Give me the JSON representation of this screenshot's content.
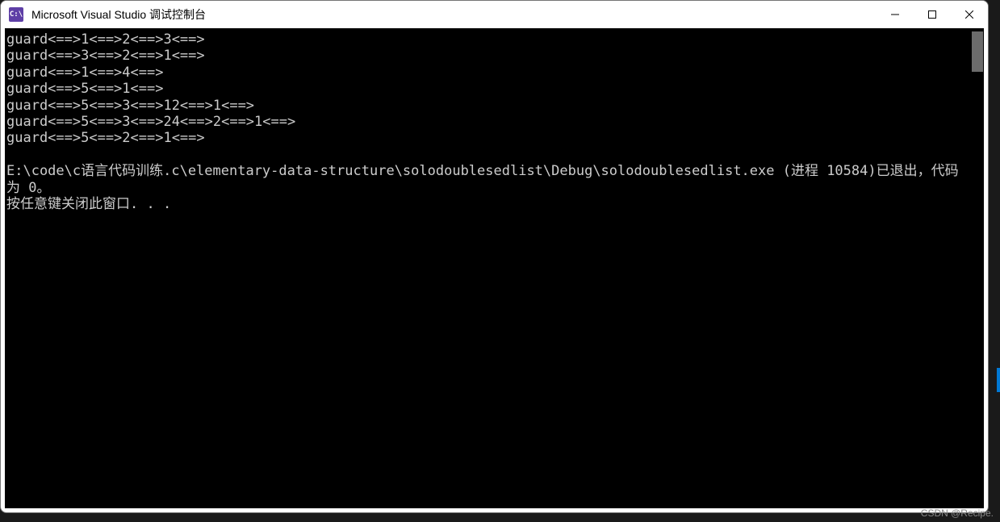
{
  "window": {
    "title": "Microsoft Visual Studio 调试控制台",
    "icon_text": "C:\\"
  },
  "console": {
    "lines": [
      "guard<==>1<==>2<==>3<==>",
      "guard<==>3<==>2<==>1<==>",
      "guard<==>1<==>4<==>",
      "guard<==>5<==>1<==>",
      "guard<==>5<==>3<==>12<==>1<==>",
      "guard<==>5<==>3<==>24<==>2<==>1<==>",
      "guard<==>5<==>2<==>1<==>",
      "",
      "E:\\code\\c语言代码训练.c\\elementary-data-structure\\solodoublesedlist\\Debug\\solodoublesedlist.exe (进程 10584)已退出，代码",
      "为 0。",
      "按任意键关闭此窗口. . ."
    ]
  },
  "watermark": "CSDN @Recipe."
}
